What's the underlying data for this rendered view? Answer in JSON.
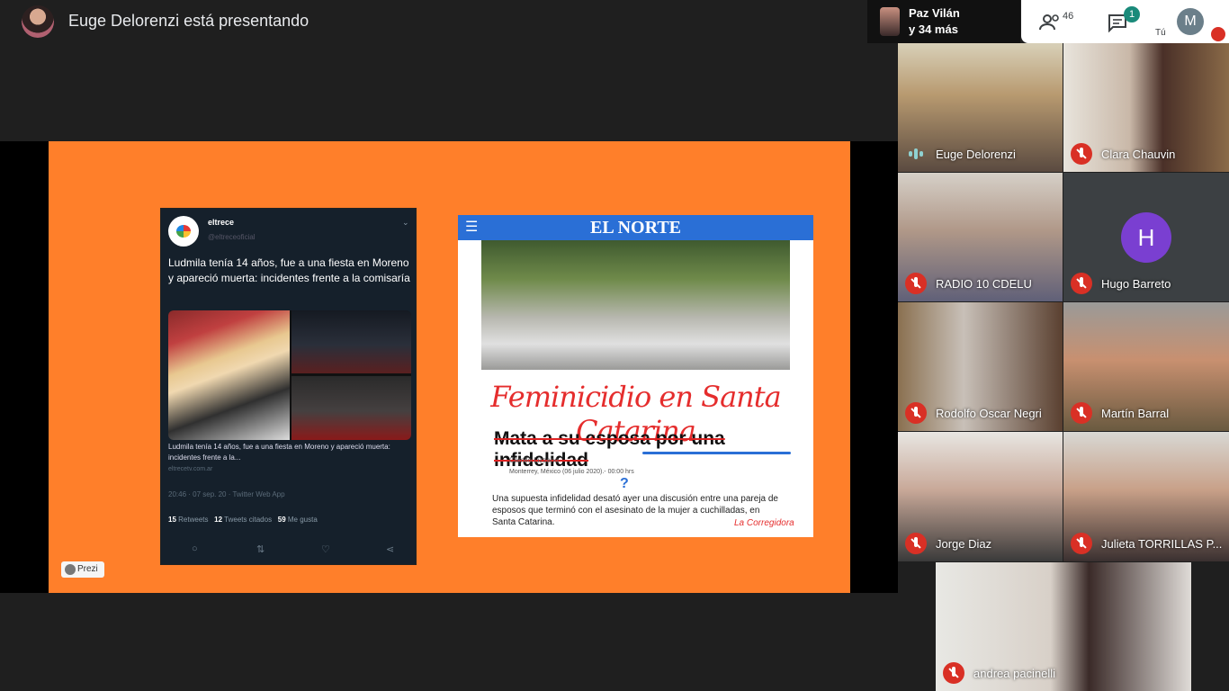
{
  "presenter": {
    "title": "Euge Delorenzi está presentando"
  },
  "others": {
    "name": "Paz Vilán",
    "more": "y 34 más"
  },
  "toolbar": {
    "people_count": "46",
    "chat_badge": "1",
    "me_initial": "M",
    "me_label": "Tú"
  },
  "slide": {
    "prezi": "Prezi",
    "tweet": {
      "name": "eltrece",
      "handle": "@eltreceoficial",
      "text": "Ludmila tenía 14 años, fue a una fiesta en Moreno y apareció muerta: incidentes frente a la comisaría",
      "card_text": "Ludmila tenía 14 años, fue a una fiesta en Moreno y apareció muerta: incidentes frente a la...",
      "card_url": "eltrecetv.com.ar",
      "meta": "20:46 · 07 sep. 20 · Twitter Web App",
      "retweets": "15",
      "retweets_label": "Retweets",
      "quotes": "12",
      "quotes_label": "Tweets citados",
      "likes": "59",
      "likes_label": "Me gusta"
    },
    "news": {
      "brand": "EL NORTE",
      "headline": "Feminicidio en Santa Catarina",
      "strikeline": "Mata a su esposa por una infidelidad",
      "byline": "Camilo Lizzano",
      "dateline": "Monterrey, México (06 julio 2020).- 00:00 hrs",
      "q": "?",
      "body": "Una supuesta infidelidad desató ayer una discusión entre una pareja de esposos que terminó con el asesinato de la mujer a cuchilladas, en Santa Catarina.",
      "credit": "La Corregidora"
    }
  },
  "participants": [
    {
      "name": "Euge Delorenzi"
    },
    {
      "name": "Clara Chauvin"
    },
    {
      "name": "RADIO 10 CDELU"
    },
    {
      "name": "Hugo Barreto",
      "initial": "H"
    },
    {
      "name": "Rodolfo Oscar Negri"
    },
    {
      "name": "Martín Barral"
    },
    {
      "name": "Jorge Diaz"
    },
    {
      "name": "Julieta TORRILLAS P..."
    },
    {
      "name": "andrea pacinelli"
    }
  ]
}
